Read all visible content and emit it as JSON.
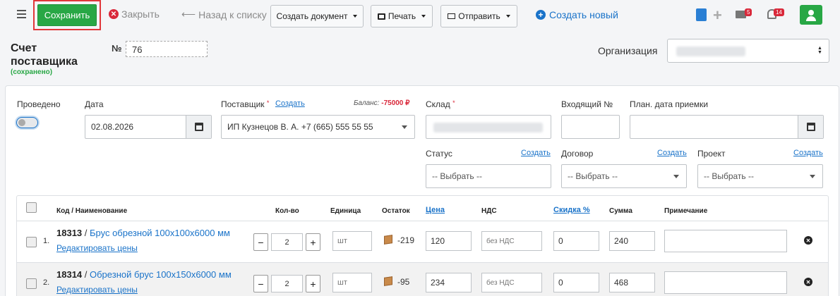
{
  "toolbar": {
    "save_label": "Сохранить",
    "close_label": "Закрыть",
    "back_label": "Назад к списку",
    "create_doc_label": "Создать документ",
    "print_label": "Печать",
    "send_label": "Отправить",
    "create_new_label": "Создать новый",
    "mail_count": "5",
    "notif_count": "14"
  },
  "header": {
    "title_line1": "Счет",
    "title_line2": "поставщика",
    "status": "(сохранено)",
    "number_label": "№",
    "number_value": "76",
    "org_label": "Организация"
  },
  "form": {
    "posted_label": "Проведено",
    "date_label": "Дата",
    "date_value": "02.08.2026",
    "supplier_label": "Поставщик",
    "supplier_create": "Создать",
    "balance_label": "Баланс:",
    "balance_value": "-75000 ₽",
    "supplier_value": "ИП Кузнецов В. А. +7 (665) 555 55 55",
    "warehouse_label": "Склад",
    "incoming_label": "Входящий №",
    "receipt_date_label": "План. дата приемки",
    "status_label": "Статус",
    "status_create": "Создать",
    "status_placeholder": "-- Выбрать --",
    "contract_label": "Договор",
    "contract_create": "Создать",
    "contract_placeholder": "-- Выбрать --",
    "project_label": "Проект",
    "project_create": "Создать",
    "project_placeholder": "-- Выбрать --"
  },
  "table": {
    "headers": {
      "name": "Код / Наименование",
      "qty": "Кол-во",
      "unit": "Единица",
      "stock": "Остаток",
      "price": "Цена",
      "vat": "НДС",
      "discount": "Скидка %",
      "sum": "Сумма",
      "note": "Примечание"
    },
    "rows": [
      {
        "num": "1.",
        "code": "18313",
        "name": "Брус обрезной 100x100x6000 мм",
        "edit": "Редактировать цены",
        "qty": "2",
        "unit": "шт",
        "stock": "-219",
        "price": "120",
        "vat": "без НДС",
        "discount": "0",
        "sum": "240"
      },
      {
        "num": "2.",
        "code": "18314",
        "name": "Обрезной брус 100x150x6000 мм",
        "edit": "Редактировать цены",
        "qty": "2",
        "unit": "шт",
        "stock": "-95",
        "price": "234",
        "vat": "без НДС",
        "discount": "0",
        "sum": "468"
      }
    ]
  },
  "icons": {
    "menu": "hamburger-icon",
    "close": "x-circle-icon",
    "back": "arrow-left-icon",
    "print": "printer-icon",
    "send": "envelope-icon",
    "create": "plus-circle-icon",
    "calculator": "calculator-icon",
    "mail": "mail-icon",
    "notifications": "bell-icon",
    "user": "user-icon",
    "calendar": "calendar-icon",
    "stock": "box-icon",
    "delete": "times-circle-icon"
  },
  "colors": {
    "primary_green": "#28a745",
    "link_blue": "#1a73c9",
    "danger_red": "#d9283a",
    "highlight_border": "#e0373a"
  }
}
